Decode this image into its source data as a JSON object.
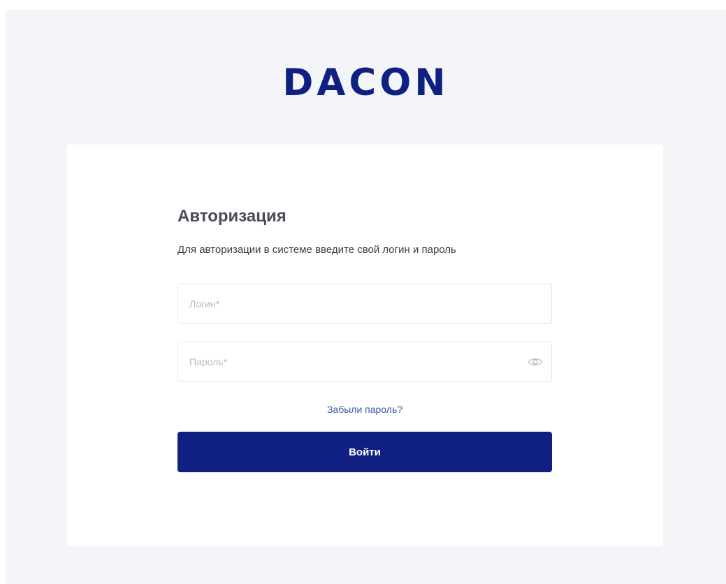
{
  "brand": {
    "logo_text": "DACON",
    "color": "#0f1f82"
  },
  "login_form": {
    "title": "Авторизация",
    "subtitle": "Для авторизации в системе введите свой логин и пароль",
    "login_field": {
      "placeholder": "Логин*",
      "value": ""
    },
    "password_field": {
      "placeholder": "Пароль*",
      "value": "",
      "toggle_icon": "eye-icon"
    },
    "forgot_link": "Забыли пароль?",
    "submit_label": "Войти"
  },
  "colors": {
    "background": "#f4f5f9",
    "card": "#ffffff",
    "primary": "#0f1f82",
    "link": "#3a5aa3"
  }
}
